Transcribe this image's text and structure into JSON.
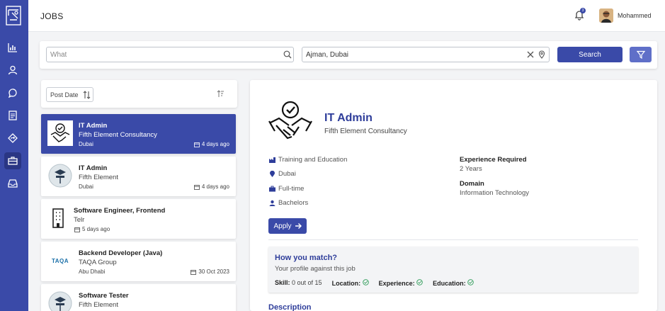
{
  "header": {
    "title": "JOBS",
    "notification_count": "3",
    "user_name": "Mohammed"
  },
  "search": {
    "what_placeholder": "What",
    "where_value": "Ajman, Dubai",
    "search_label": "Search"
  },
  "sort": {
    "label": "Post Date"
  },
  "jobs": [
    {
      "title": "IT Admin",
      "company": "Fifth Element Consultancy",
      "location": "Dubai",
      "date": "4 days ago",
      "logo": "handshake-icon"
    },
    {
      "title": "IT Admin",
      "company": "Fifth Element",
      "location": "Dubai",
      "date": "4 days ago",
      "logo": "graduation-logo"
    },
    {
      "title": "Software Engineer, Frontend",
      "company": "Telr",
      "location": "",
      "date": "5 days ago",
      "logo": "building-icon"
    },
    {
      "title": "Backend Developer (Java)",
      "company": "TAQA Group",
      "location": "Abu Dhabi",
      "date": "30 Oct 2023",
      "logo": "taqa-logo"
    },
    {
      "title": "Software Tester",
      "company": "Fifth Element",
      "location": "",
      "date": "",
      "logo": "graduation-logo"
    }
  ],
  "taqa_logo_text": "TAQA",
  "detail": {
    "title": "IT Admin",
    "company": "Fifth Element Consultancy",
    "industry": "Training and Education",
    "location": "Dubai",
    "job_type": "Full-time",
    "education": "Bachelors",
    "experience_label": "Experience Required",
    "experience_value": "2 Years",
    "domain_label": "Domain",
    "domain_value": "Information Technology",
    "apply_label": "Apply",
    "match": {
      "heading": "How you match?",
      "subtitle": "Your profile against this job",
      "skill_label": "Skill:",
      "skill_value": "0 out of 15",
      "location_label": "Location:",
      "experience_label": "Experience:",
      "education_label": "Education:"
    },
    "description_label": "Description"
  },
  "colors": {
    "primary": "#3a4aa8",
    "accent": "#2e3d9a",
    "check": "#2a9a55"
  }
}
